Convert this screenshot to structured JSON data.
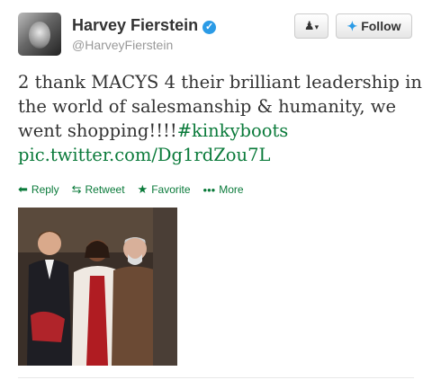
{
  "author": {
    "name": "Harvey Fierstein",
    "handle": "@HarveyFierstein",
    "verified_icon": "verified-check-icon"
  },
  "buttons": {
    "user_menu_icon": "user-icon",
    "follow_label": "Follow"
  },
  "tweet": {
    "text": "2 thank MACYS 4 their brilliant leadership in the world of salesmanship & humanity, we went shopping!!!!",
    "hashtag": "#kinkyboots",
    "media_link": "pic.twitter.com/Dg1rdZou7L"
  },
  "actions": [
    {
      "label": "Reply",
      "icon": "reply-icon"
    },
    {
      "label": "Retweet",
      "icon": "retweet-icon"
    },
    {
      "label": "Favorite",
      "icon": "star-icon"
    },
    {
      "label": "More",
      "icon": "more-icon"
    }
  ],
  "colors": {
    "link": "#0a7a3a",
    "verified": "#2b9be6"
  }
}
